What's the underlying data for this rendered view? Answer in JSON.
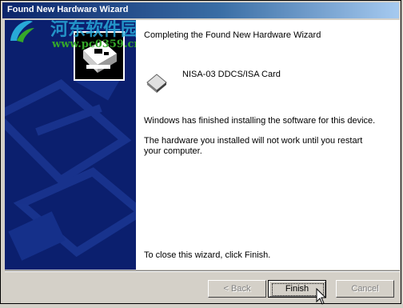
{
  "window": {
    "title": "Found New Hardware Wizard"
  },
  "watermark": {
    "site_name": "河东软件园",
    "url": "www.pc0359.cn"
  },
  "content": {
    "heading": "Completing the Found New Hardware Wizard",
    "device_name": "NISA-03 DDCS/ISA Card",
    "finished_text": "Windows has finished installing the software for this device.",
    "warning_line1": "The hardware you installed will not work until you restart",
    "warning_line2": "your computer.",
    "close_instruction": "To close this wizard, click Finish."
  },
  "buttons": {
    "back_label": "< Back",
    "finish_label": "Finish",
    "cancel_label": "Cancel"
  },
  "colors": {
    "titlebar_start": "#0a246a",
    "titlebar_end": "#a6caf0",
    "left_panel": "#0b1f6e"
  }
}
